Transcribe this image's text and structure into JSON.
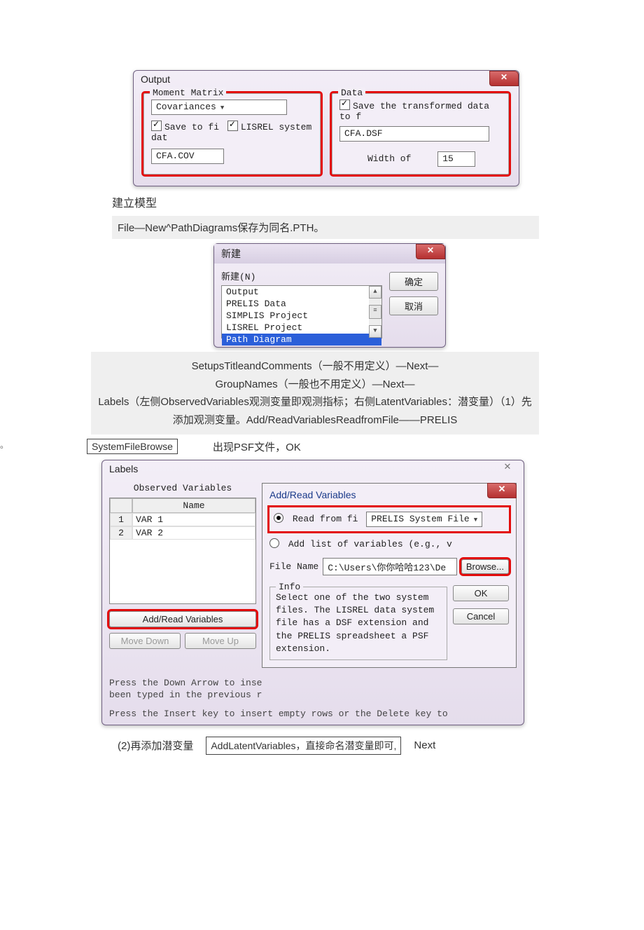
{
  "output_dialog": {
    "title": "Output",
    "moment_matrix": {
      "legend": "Moment Matrix",
      "dropdown_value": "Covariances",
      "save_to_fi_label": "Save to fi",
      "lisrel_sys_label": "LISREL system dat",
      "cov_file": "CFA.COV"
    },
    "data_group": {
      "legend": "Data",
      "save_transformed_label": "Save the transformed data to f",
      "dsf_file": "CFA.DSF",
      "width_label": "Width of",
      "width_value": "15"
    }
  },
  "caption_model": "建立模型",
  "step_new": "File—New^PathDiagrams保存为同名.PTH。",
  "new_dialog": {
    "title": "新建",
    "label": "新建(N)",
    "options": [
      "Output",
      "PRELIS Data",
      "SIMPLIS Project",
      "LISREL Project",
      "Path Diagram"
    ],
    "ok": "确定",
    "cancel": "取消"
  },
  "gray_text": "SetupsTitleandComments（一般不用定义）—Next—\nGroupNames（一般也不用定义）—Next—\nLabels（左侧ObservedVariables观测变量即观测指标；右侧LatentVariables：潜变量）（1）先添加观测变量。Add/ReadVariablesReadfromFile——PRELIS",
  "left_margin_char": "。",
  "sys_browse_box": "SystemFileBrowse",
  "psf_note": "出现PSF文件，OK",
  "labels_dialog": {
    "title": "Labels",
    "close": "✕",
    "observed_header": "Observed Variables",
    "name_col": "Name",
    "rows": [
      {
        "idx": "1",
        "name": "VAR 1"
      },
      {
        "idx": "2",
        "name": "VAR 2"
      }
    ],
    "add_read_btn": "Add/Read Variables",
    "move_down": "Move Down",
    "move_up": "Move Up",
    "hint1": "Press the Down Arrow to inse",
    "hint2": "been typed in the previous r",
    "hint3": "Press the Insert key to insert empty rows or the Delete key to"
  },
  "add_read_dialog": {
    "title": "Add/Read Variables",
    "read_from_label": "Read from fi",
    "read_from_value": "PRELIS System File",
    "add_list_label": "Add list of variables (e.g., v",
    "file_name_label": "File Name",
    "file_name_value": "C:\\Users\\你你哈哈123\\De",
    "browse": "Browse...",
    "info_legend": "Info",
    "info_text": "Select one of the two system files. The LISREL data system file has a DSF extension and the PRELIS spreadsheet a PSF extension.",
    "ok": "OK",
    "cancel": "Cancel"
  },
  "footer": {
    "left": "(2)再添加潜变量",
    "mid": "AddLatentVariables，直接命名潜变量即可,",
    "right": "Next"
  }
}
